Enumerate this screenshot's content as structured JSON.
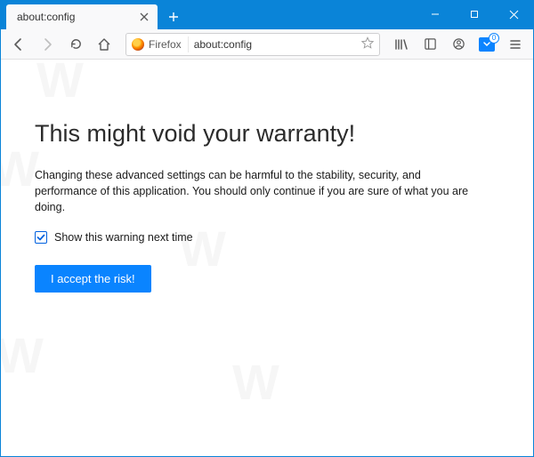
{
  "tab": {
    "title": "about:config"
  },
  "identity": {
    "label": "Firefox"
  },
  "url": "about:config",
  "toolbar": {
    "pocketBadge": "0"
  },
  "page": {
    "heading": "This might void your warranty!",
    "body": "Changing these advanced settings can be harmful to the stability, security, and performance of this application. You should only continue if you are sure of what you are doing.",
    "checkboxLabel": "Show this warning next time",
    "acceptLabel": "I accept the risk!"
  }
}
